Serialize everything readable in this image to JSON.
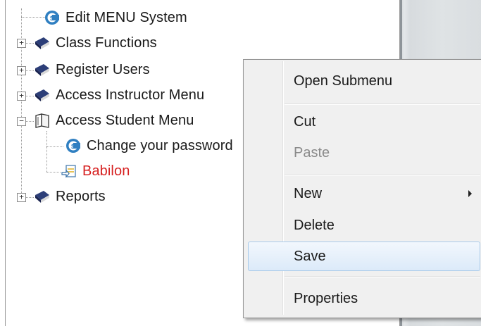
{
  "tree": {
    "items": [
      {
        "label": "Edit MENU System",
        "icon": "cs-logo-icon"
      },
      {
        "label": "Class Functions",
        "icon": "book-icon"
      },
      {
        "label": "Register Users",
        "icon": "book-icon"
      },
      {
        "label": "Access Instructor Menu",
        "icon": "book-icon"
      },
      {
        "label": "Access Student Menu",
        "icon": "open-book-icon"
      },
      {
        "label": "Change your password",
        "icon": "cs-logo-icon"
      },
      {
        "label": "Babilon",
        "icon": "form-icon"
      },
      {
        "label": "Reports",
        "icon": "book-icon"
      }
    ],
    "expander_plus": "+",
    "expander_minus": "−"
  },
  "context_menu": {
    "items": [
      {
        "label": "Open Submenu",
        "enabled": true
      },
      {
        "label": "Cut",
        "enabled": true
      },
      {
        "label": "Paste",
        "enabled": false
      },
      {
        "label": "New",
        "enabled": true,
        "has_submenu": true
      },
      {
        "label": "Delete",
        "enabled": true
      },
      {
        "label": "Save",
        "enabled": true,
        "highlighted": true
      },
      {
        "label": "Properties",
        "enabled": true
      }
    ]
  },
  "colors": {
    "highlight_text": "#d62020",
    "menu_background": "#f0f0f0",
    "hover_border": "#a8cae9"
  }
}
